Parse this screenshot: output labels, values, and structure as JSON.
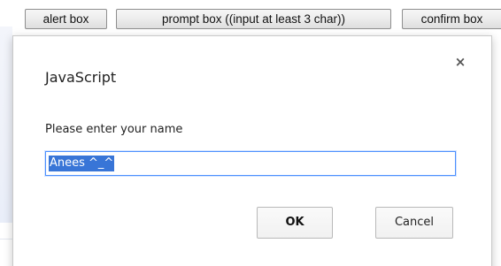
{
  "page": {
    "buttons": {
      "alert_label": "alert box",
      "prompt_label": "prompt box ((input at least 3 char))",
      "confirm_label": "confirm box"
    }
  },
  "dialog": {
    "title": "JavaScript",
    "close_icon": "×",
    "message": "Please enter your name",
    "input_value": "Anees ^_^",
    "input_selected": true,
    "ok_label": "OK",
    "cancel_label": "Cancel"
  },
  "colors": {
    "selection": "#3875d7",
    "focus_border": "#4d90fe"
  }
}
